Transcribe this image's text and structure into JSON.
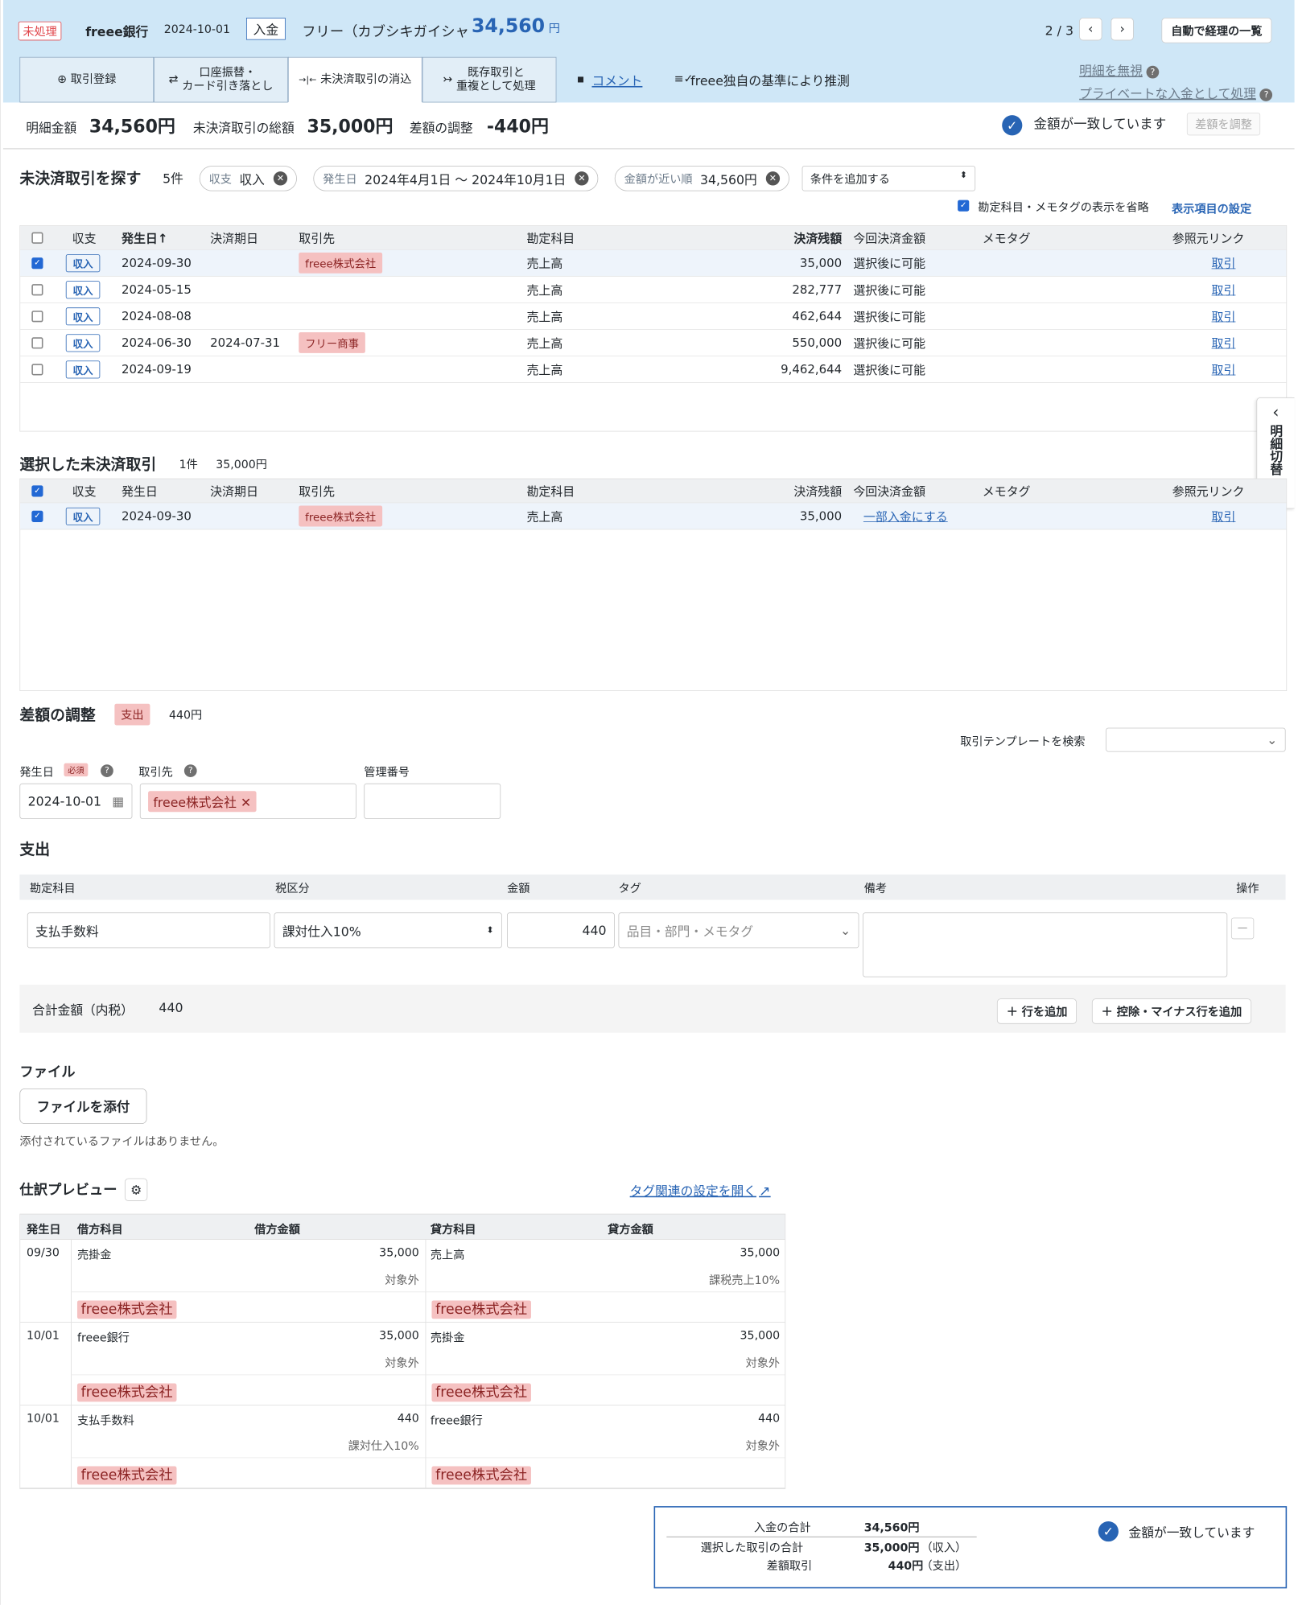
{
  "header": {
    "status": "未処理",
    "bank": "freee銀行",
    "date": "2024-10-01",
    "type": "入金",
    "description": "フリー（カブシキガイシャ",
    "amount": "34,560",
    "yen": "円",
    "pager": "2 / 3",
    "prev": "‹",
    "next": "›",
    "list_button": "自動で経理の一覧",
    "tabs": [
      {
        "icon": "⊕",
        "label": "取引登録"
      },
      {
        "icon": "⇄",
        "label": "口座振替・\nカード引き落とし"
      },
      {
        "icon": "→|←",
        "label": "未決済取引の消込"
      },
      {
        "icon": "↣",
        "label": "既存取引と\n重複として処理"
      }
    ],
    "comment_icon": "▪",
    "comment": "コメント",
    "guess_icon": "≡✓",
    "guess": "freee独自の基準により推測",
    "ignore": "明細を無視",
    "private": "プライベートな入金として処理",
    "help": "?"
  },
  "summary": {
    "detail_label": "明細金額",
    "detail_value": "34,560円",
    "unsettled_label": "未決済取引の総額",
    "unsettled_value": "35,000円",
    "diff_label": "差額の調整",
    "diff_value": "-440円",
    "match": "金額が一致しています",
    "adjust_button": "差額を調整",
    "check": "✓"
  },
  "search": {
    "title": "未決済取引を探す",
    "count": "5件",
    "filters": [
      {
        "label": "収支",
        "value": "収入"
      },
      {
        "label": "発生日",
        "value": "2024年4月1日 〜 2024年10月1日"
      },
      {
        "label": "金額が近い順",
        "value": "34,560円"
      }
    ],
    "filter_x": "✕",
    "add_condition": "条件を追加する",
    "select_arrow": "⬍",
    "omit_label": "勘定科目・メモタグの表示を省略",
    "display_settings": "表示項目の設定",
    "columns": [
      "収支",
      "発生日↑",
      "決済期日",
      "取引先",
      "勘定科目",
      "決済残額",
      "今回決済金額",
      "メモタグ",
      "参照元リンク"
    ],
    "rows": [
      {
        "checked": true,
        "kind": "収入",
        "date": "2024-09-30",
        "due": "",
        "partner": "freee株式会社",
        "account": "売上高",
        "balance": "35,000",
        "pay": "選択後に可能",
        "link": "取引"
      },
      {
        "checked": false,
        "kind": "収入",
        "date": "2024-05-15",
        "due": "",
        "partner": "",
        "account": "売上高",
        "balance": "282,777",
        "pay": "選択後に可能",
        "link": "取引"
      },
      {
        "checked": false,
        "kind": "収入",
        "date": "2024-08-08",
        "due": "",
        "partner": "",
        "account": "売上高",
        "balance": "462,644",
        "pay": "選択後に可能",
        "link": "取引"
      },
      {
        "checked": false,
        "kind": "収入",
        "date": "2024-06-30",
        "due": "2024-07-31",
        "partner": "フリー商事",
        "account": "売上高",
        "balance": "550,000",
        "pay": "選択後に可能",
        "link": "取引"
      },
      {
        "checked": false,
        "kind": "収入",
        "date": "2024-09-19",
        "due": "",
        "partner": "",
        "account": "売上高",
        "balance": "9,462,644",
        "pay": "選択後に可能",
        "link": "取引"
      }
    ]
  },
  "side_toggle": {
    "arrow": "‹",
    "label": "明細切替"
  },
  "selected": {
    "title": "選択した未決済取引",
    "count": "1件",
    "total": "35,000円",
    "columns": [
      "収支",
      "発生日",
      "決済期日",
      "取引先",
      "勘定科目",
      "決済残額",
      "今回決済金額",
      "メモタグ",
      "参照元リンク"
    ],
    "rows": [
      {
        "kind": "収入",
        "date": "2024-09-30",
        "partner": "freee株式会社",
        "account": "売上高",
        "balance": "35,000",
        "pay": "一部入金にする",
        "link": "取引"
      }
    ]
  },
  "adjust": {
    "title": "差額の調整",
    "kind": "支出",
    "amount": "440円",
    "template_label": "取引テンプレートを検索",
    "template_arrow": "⌄",
    "date_label": "発生日",
    "required": "必須",
    "date_value": "2024-10-01",
    "calendar_icon": "▦",
    "partner_label": "取引先",
    "partner_value": "freee株式会社",
    "partner_x": "✕",
    "mgmt_label": "管理番号"
  },
  "expense": {
    "title": "支出",
    "columns": [
      "勘定科目",
      "税区分",
      "金額",
      "タグ",
      "備考",
      "操作"
    ],
    "account": "支払手数料",
    "tax": "課対仕入10%",
    "tax_arrow": "⬍",
    "amount": "440",
    "tag_placeholder": "品目・部門・メモタグ",
    "tag_arrow": "⌄",
    "remove": "—",
    "total_label": "合計金額（内税）",
    "total_value": "440",
    "add_row": "行を追加",
    "add_minus": "控除・マイナス行を追加",
    "plus": "＋"
  },
  "files": {
    "title": "ファイル",
    "attach": "ファイルを添付",
    "none": "添付されているファイルはありません。"
  },
  "journal": {
    "title": "仕訳プレビュー",
    "gear": "⚙",
    "tag_settings": "タグ関連の設定を開く",
    "ext": "↗",
    "columns": [
      "発生日",
      "借方科目",
      "借方金額",
      "貸方科目",
      "貸方金額"
    ],
    "entries": [
      {
        "date": "09/30",
        "debit": "売掛金",
        "debit_amount": "35,000",
        "debit_tax": "対象外",
        "credit": "売上高",
        "credit_amount": "35,000",
        "credit_tax": "課税売上10%",
        "partner": "freee株式会社"
      },
      {
        "date": "10/01",
        "debit": "freee銀行",
        "debit_amount": "35,000",
        "debit_tax": "対象外",
        "credit": "売掛金",
        "credit_amount": "35,000",
        "credit_tax": "対象外",
        "partner": "freee株式会社"
      },
      {
        "date": "10/01",
        "debit": "支払手数料",
        "debit_amount": "440",
        "debit_tax": "課対仕入10%",
        "credit": "freee銀行",
        "credit_amount": "440",
        "credit_tax": "対象外",
        "partner": "freee株式会社"
      }
    ]
  },
  "final": {
    "deposit_label": "入金の合計",
    "deposit_value": "34,560円",
    "selected_label": "選択した取引の合計",
    "selected_value": "35,000円",
    "selected_kind": "（収入）",
    "diff_label": "差額取引",
    "diff_value": "440円",
    "diff_kind": "（支出）",
    "match": "金額が一致しています",
    "check": "✓"
  },
  "colors": {
    "accent": "#2864b4",
    "header_bg": "#cfe7f7",
    "tag_pink": "#f5c1c1",
    "status_red": "#e0454a"
  }
}
